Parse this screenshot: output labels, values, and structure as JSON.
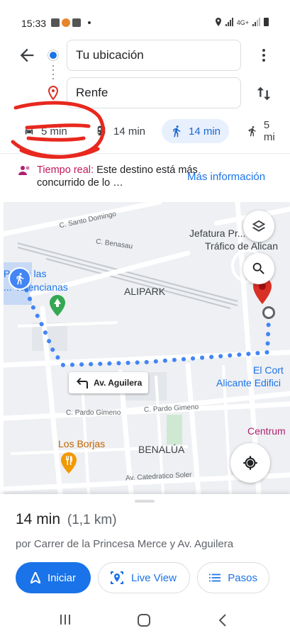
{
  "status_bar": {
    "time": "15:33",
    "network": "4G+"
  },
  "route": {
    "origin": "Tu ubicación",
    "destination": "Renfe"
  },
  "travel_modes": [
    {
      "id": "drive",
      "icon": "car-icon",
      "time": "5 min",
      "active": false
    },
    {
      "id": "transit",
      "icon": "train-icon",
      "time": "14 min",
      "active": false
    },
    {
      "id": "walk",
      "icon": "walking-icon",
      "time": "14 min",
      "active": true
    },
    {
      "id": "ride",
      "icon": "ride-hailing-icon",
      "time": "5 mi",
      "active": false
    }
  ],
  "notice": {
    "highlight": "Tiempo real:",
    "text": " Este destino está más concurrido de lo …",
    "link": "Más información"
  },
  "map": {
    "labels": {
      "santo_domingo": "C. Santo Domingo",
      "benasau": "C. Benasau",
      "jefatura_1": "Jefatura Pr... al de",
      "jefatura_2": "Tráfico de Alican",
      "alipark": "ALIPARK",
      "plaza_1": "P... de las",
      "plaza_2": "... Valencianas",
      "corte_1": "El Cort",
      "corte_2": "Alicante Edifici",
      "pardo_1": "C. Pardo Gimeno",
      "pardo_2": "C. Pardo Gimeno",
      "centrum": "Centrum",
      "borjas": "Los Borjas",
      "benalua": "BENALÚA",
      "catedratico": "Av. Catedratico Soler"
    },
    "turn_chip": "Av. Aguilera"
  },
  "summary": {
    "duration": "14 min",
    "distance": "(1,1 km)",
    "via": "por Carrer de la Princesa Merce y Av. Aguilera"
  },
  "actions": {
    "start": "Iniciar",
    "live_view": "Live View",
    "steps": "Pasos"
  },
  "colors": {
    "accent": "#1a73e8",
    "route": "#4285f4",
    "destination": "#d93025",
    "annotation": "#e8281e"
  }
}
